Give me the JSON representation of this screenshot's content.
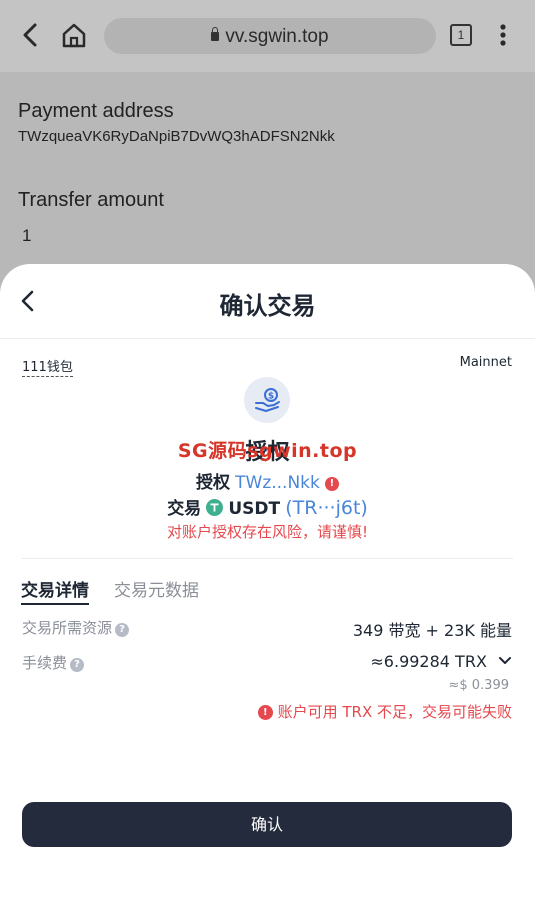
{
  "browser": {
    "url": "vv.sgwin.top",
    "tab_count": "1"
  },
  "background_page": {
    "payment_address_label": "Payment address",
    "payment_address_value": "TWzqueaVK6RyDaNpiB7DvWQ3hADFSN2Nkk",
    "transfer_amount_label": "Transfer amount",
    "transfer_amount_value": "1"
  },
  "sheet": {
    "title": "确认交易",
    "wallet_name": "111钱包",
    "network": "Mainnet",
    "action_title": "授权",
    "watermark": "SG源码sgwin.top",
    "authorize_label": "授权",
    "authorize_address": "TWz...Nkk",
    "trade_label": "交易",
    "token_symbol": "USDT",
    "token_address": "(TR···j6t)",
    "risk_warning": "对账户授权存在风险，请谨慎!",
    "tabs": [
      {
        "label": "交易详情",
        "active": true
      },
      {
        "label": "交易元数据",
        "active": false
      }
    ],
    "resources_label": "交易所需资源",
    "resources_value": "349 带宽 + 23K 能量",
    "fee_label": "手续费",
    "fee_value": "≈6.99284 TRX",
    "fee_usd": "≈$ 0.399",
    "fee_warning": "账户可用 TRX 不足，交易可能失败",
    "confirm_label": "确认"
  },
  "colors": {
    "accent_dark": "#242b3d",
    "link_blue": "#4a86d8",
    "danger_red": "#e5484d",
    "tether_green": "#3fb08f"
  },
  "icons": [
    "back-arrow-icon",
    "home-icon",
    "lock-icon",
    "tab-count-icon",
    "more-vert-icon",
    "hand-coin-icon",
    "warning-icon",
    "tether-icon",
    "help-icon",
    "chevron-down-icon"
  ]
}
